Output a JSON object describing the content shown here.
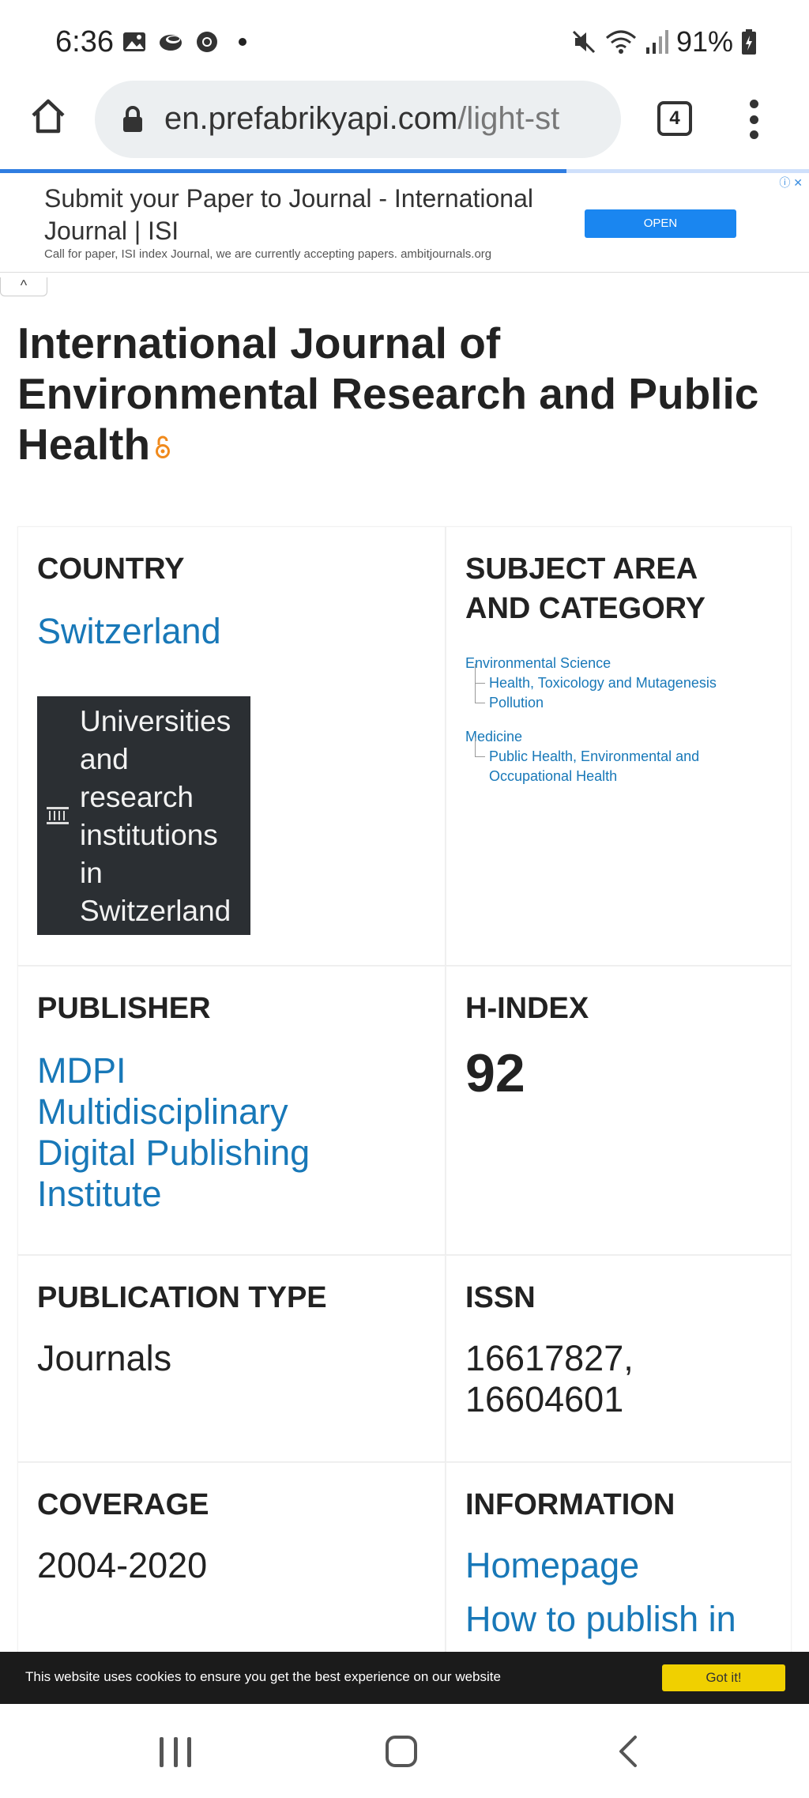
{
  "status_bar": {
    "time": "6:36",
    "battery": "91%",
    "left_icons": [
      "gallery-icon",
      "cloud-icon",
      "chrome-icon",
      "dot"
    ],
    "right_icons": [
      "mute-icon",
      "wifi-icon",
      "signal-icon",
      "battery-icon"
    ]
  },
  "browser": {
    "url_main": "en.prefabrikyapi.com",
    "url_path": "/light-st",
    "tab_count": "4",
    "load_progress": 0.7
  },
  "ad": {
    "title": "Submit your Paper to Journal - International Journal | ISI",
    "description": "Call for paper, ISI index Journal, we are currently accepting papers. ambitjournals.org",
    "button": "OPEN",
    "choices": "ⓘ ✕"
  },
  "collapse_symbol": "^",
  "journal": {
    "title": "International Journal of Environmental Research and Public Health"
  },
  "sections": {
    "country": {
      "heading": "COUNTRY",
      "value": "Switzerland",
      "universities_label": "Universities and research institutions in Switzerland"
    },
    "subject": {
      "heading": "SUBJECT AREA AND CATEGORY",
      "areas": [
        {
          "name": "Environmental Science",
          "categories": [
            "Health, Toxicology and Mutagenesis",
            "Pollution"
          ]
        },
        {
          "name": "Medicine",
          "categories": [
            "Public Health, Environmental and Occupational Health"
          ]
        }
      ]
    },
    "publisher": {
      "heading": "PUBLISHER",
      "value": "MDPI Multidisciplinary Digital Publishing Institute"
    },
    "hindex": {
      "heading": "H-INDEX",
      "value": "92"
    },
    "publication_type": {
      "heading": "PUBLICATION TYPE",
      "value": "Journals"
    },
    "issn": {
      "heading": "ISSN",
      "value": "16617827, 16604601"
    },
    "coverage": {
      "heading": "COVERAGE",
      "value": "2004-2020"
    },
    "information": {
      "heading": "INFORMATION",
      "links": [
        "Homepage",
        "How to publish in"
      ]
    }
  },
  "cookie": {
    "text": "This website uses cookies to ensure you get the best experience on our website",
    "button": "Got it!"
  }
}
